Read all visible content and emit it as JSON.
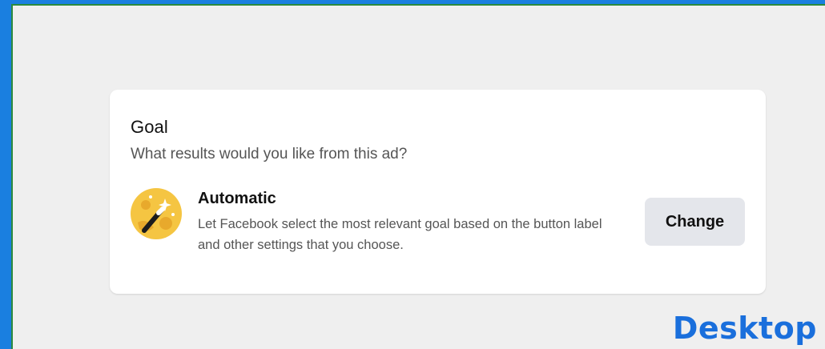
{
  "goal_card": {
    "title": "Goal",
    "subtitle": "What results would you like from this ad?",
    "option": {
      "icon": "magic-wand-icon",
      "title": "Automatic",
      "description": "Let Facebook select the most relevant goal based on the button label and other settings that you choose."
    },
    "change_label": "Change"
  },
  "platform_label": "Desktop",
  "colors": {
    "outer_border": "#1a7fe0",
    "canvas_background": "#efefef",
    "card_background": "#ffffff",
    "button_background": "#e4e6eb",
    "platform_label": "#1a6fdc",
    "icon_background": "#f5c542"
  }
}
